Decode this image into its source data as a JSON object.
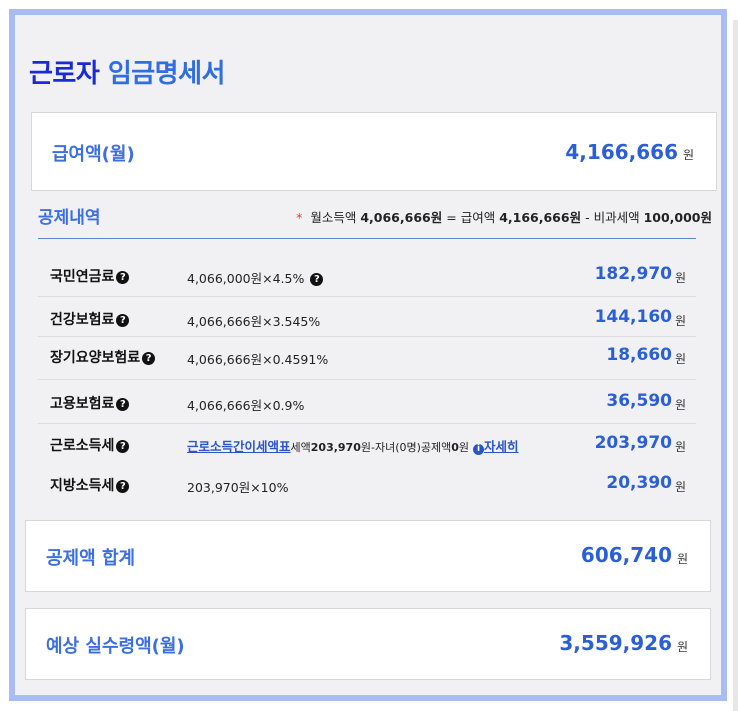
{
  "title": {
    "part1": "근로자",
    "part2": "임금명세서"
  },
  "salary": {
    "label": "급여액(월)",
    "amount": "4,166,666",
    "unit": "원"
  },
  "deduction_section": {
    "heading": "공제내역",
    "formula": {
      "star": "*",
      "prefix": "월소득액",
      "taxable": "4,066,666원",
      "eq": "=",
      "gross_label": "급여액",
      "gross": "4,166,666원",
      "minus": "-",
      "nontax_label": "비과세액",
      "nontax": "100,000원"
    },
    "rows": [
      {
        "name": "국민연금료",
        "calc": "4,066,000원×4.5%",
        "value": "182,970",
        "unit": "원"
      },
      {
        "name": "건강보험료",
        "calc": "4,066,666원×3.545%",
        "value": "144,160",
        "unit": "원"
      },
      {
        "name": "장기요양보험료",
        "calc": "4,066,666원×0.4591%",
        "value": "18,660",
        "unit": "원"
      },
      {
        "name": "고용보험료",
        "calc": "4,066,666원×0.9%",
        "value": "36,590",
        "unit": "원"
      },
      {
        "name": "근로소득세",
        "link": "근로소득간이세액표",
        "calc_tax_label": "세액",
        "calc_tax": "203,970",
        "calc_rest": "원-자녀(0명)공제액",
        "calc_zero": "0",
        "calc_won": "원",
        "detail_link": "자세히",
        "value": "203,970",
        "unit": "원"
      },
      {
        "name": "지방소득세",
        "calc": "203,970원×10%",
        "value": "20,390",
        "unit": "원"
      }
    ]
  },
  "total_deduction": {
    "label": "공제액 합계",
    "amount": "606,740",
    "unit": "원"
  },
  "net_pay": {
    "label": "예상 실수령액(월)",
    "amount": "3,559,926",
    "unit": "원"
  },
  "icons": {
    "help": "question-circle-icon",
    "info": "info-circle-icon"
  },
  "colors": {
    "accent": "#2a5fd6",
    "title_dark": "#1a2bd6",
    "frame": "#a9bdf3"
  }
}
